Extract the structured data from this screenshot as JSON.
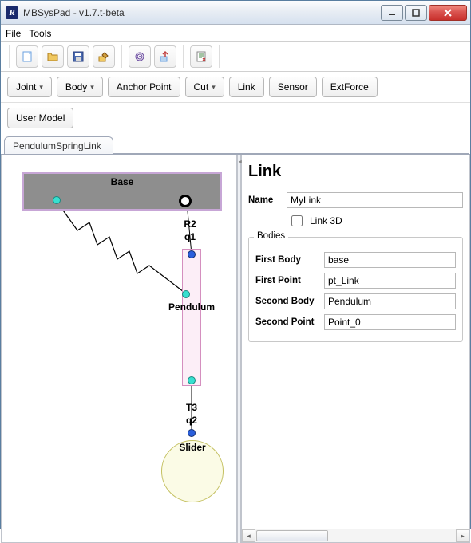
{
  "window": {
    "title": "MBSysPad - v1.7.t-beta"
  },
  "menubar": {
    "items": [
      "File",
      "Tools"
    ]
  },
  "toolbar_icons": [
    "new-file-icon",
    "open-folder-icon",
    "save-icon",
    "edit-model-icon",
    "fingerprint-icon",
    "export-icon",
    "gen-code-icon"
  ],
  "element_bar": {
    "joint": "Joint",
    "body": "Body",
    "anchor_point": "Anchor Point",
    "cut": "Cut",
    "link": "Link",
    "sensor": "Sensor",
    "extforce": "ExtForce"
  },
  "user_model_btn": "User Model",
  "tab": {
    "label": "PendulumSpringLink"
  },
  "canvas": {
    "base_label": "Base",
    "r2": "R2",
    "q1": "q1",
    "pendulum_label": "Pendulum",
    "t3": "T3",
    "q2": "q2",
    "slider_label": "Slider"
  },
  "properties": {
    "heading": "Link",
    "name_label": "Name",
    "name_value": "MyLink",
    "link3d_label": "Link 3D",
    "link3d_checked": false,
    "bodies_legend": "Bodies",
    "first_body_label": "First Body",
    "first_body_value": "base",
    "first_point_label": "First Point",
    "first_point_value": "pt_Link",
    "second_body_label": "Second Body",
    "second_body_value": "Pendulum",
    "second_point_label": "Second Point",
    "second_point_value": "Point_0"
  }
}
